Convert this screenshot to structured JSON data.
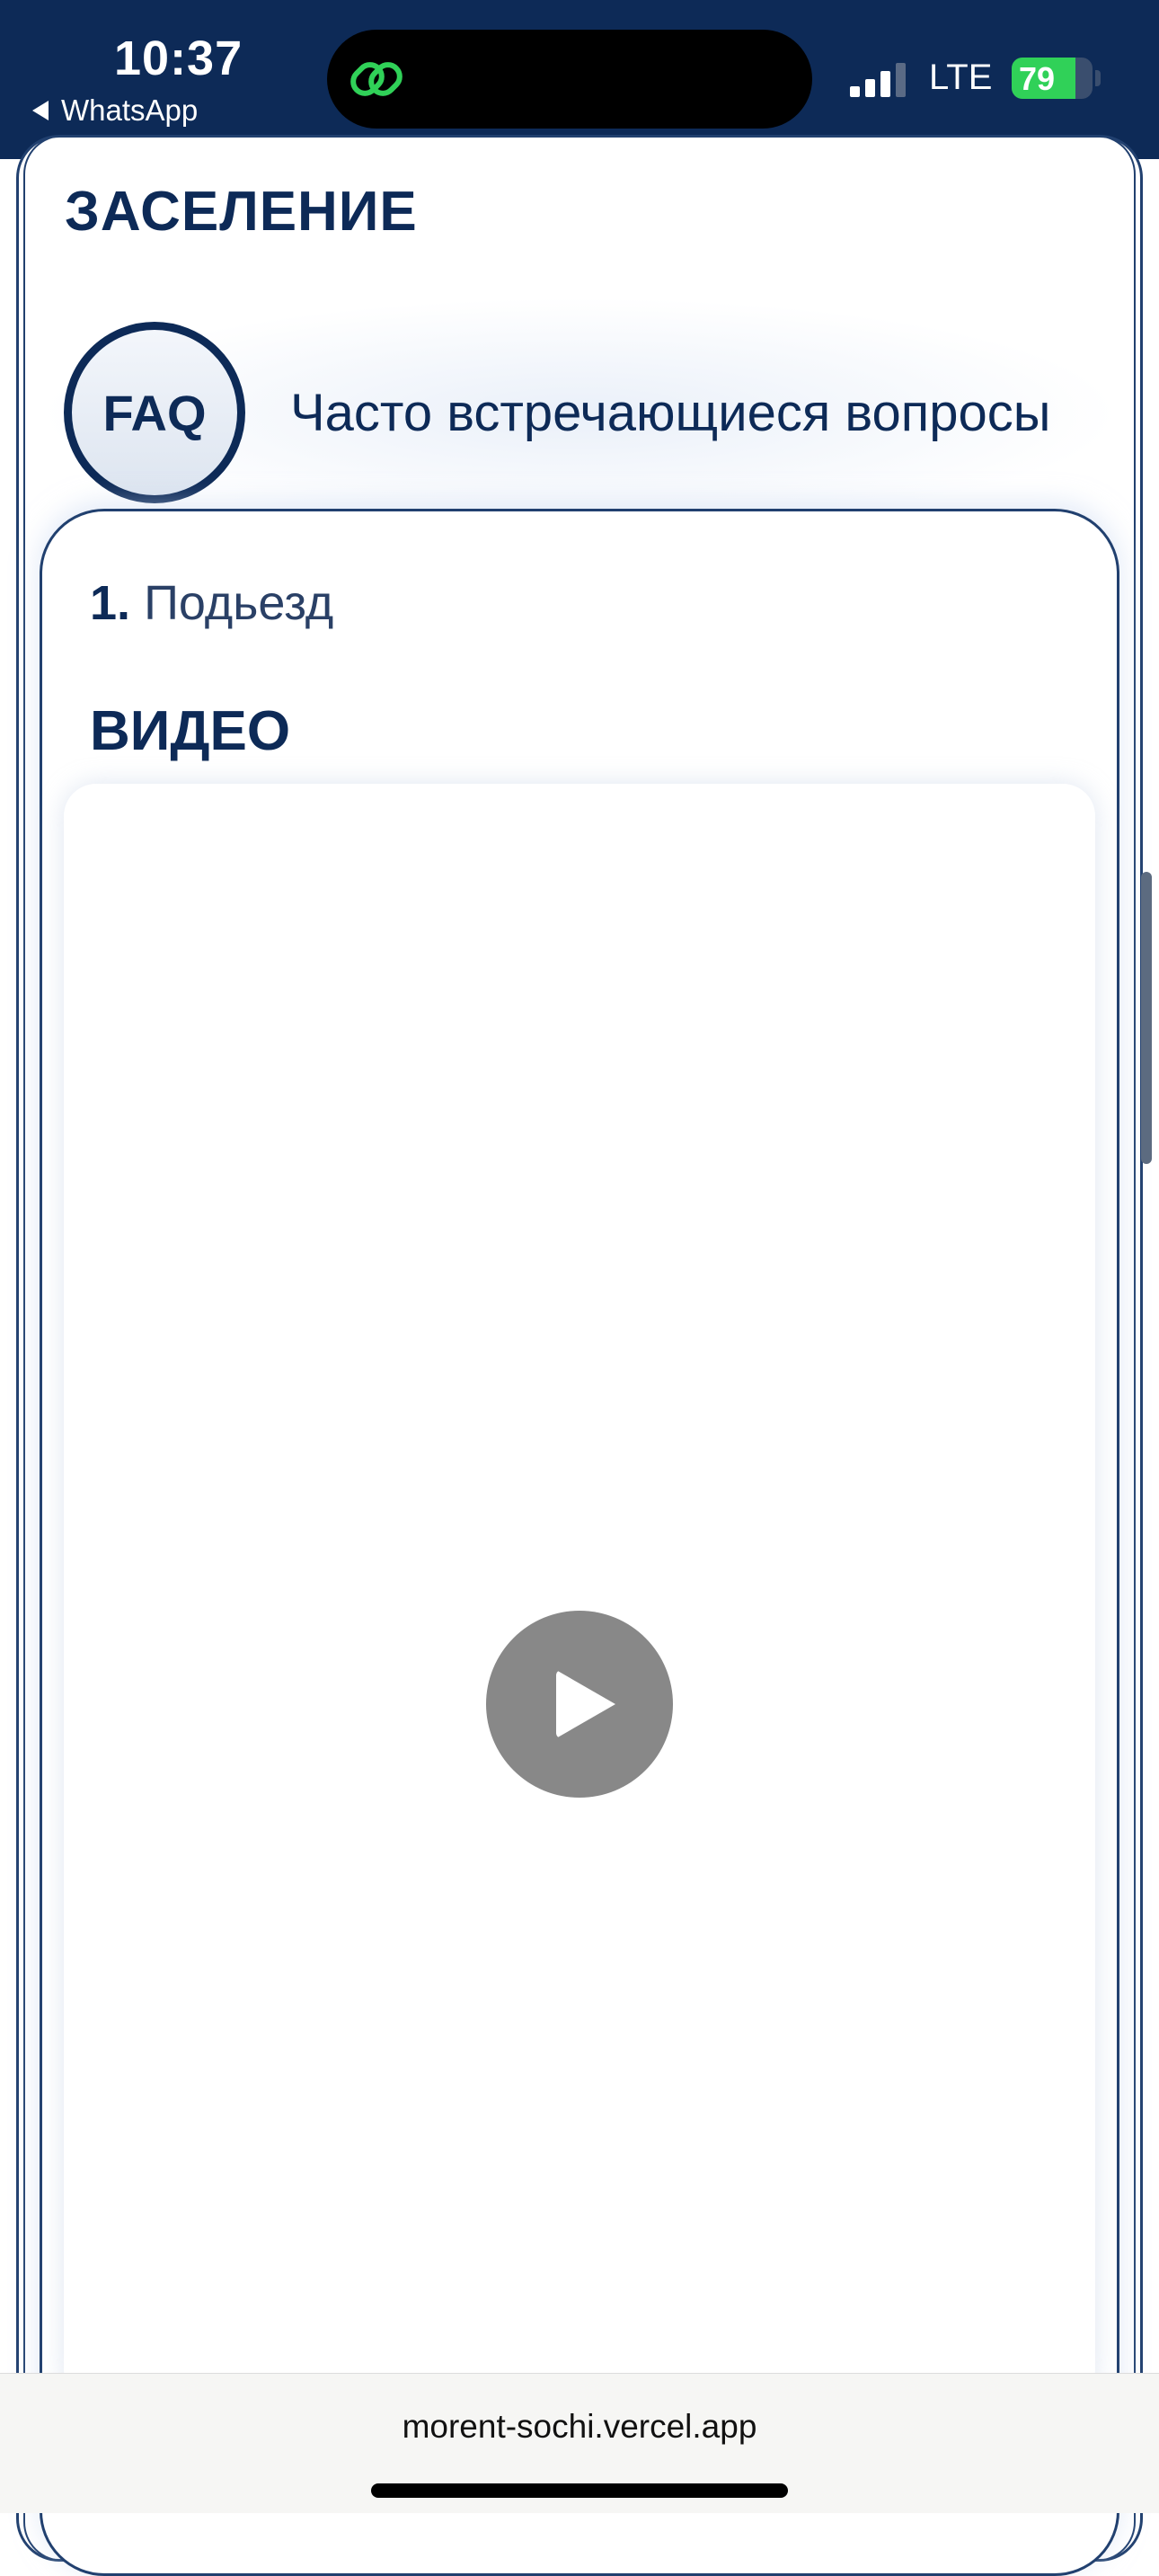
{
  "status_bar": {
    "time": "10:37",
    "back_app": "WhatsApp",
    "network": "LTE",
    "battery_level": "79",
    "battery_fraction": 0.79,
    "background_color": "#0d2a57"
  },
  "page": {
    "section_title": "ЗАСЕЛЕНИЕ",
    "faq_badge": "FAQ",
    "faq_heading": "Часто встречающиеся вопросы",
    "question": {
      "number": "1.",
      "title": "Подьезд"
    },
    "video_label": "ВИДЕО",
    "accent_color": "#0d2a57"
  },
  "browser": {
    "url": "morent-sochi.vercel.app"
  }
}
